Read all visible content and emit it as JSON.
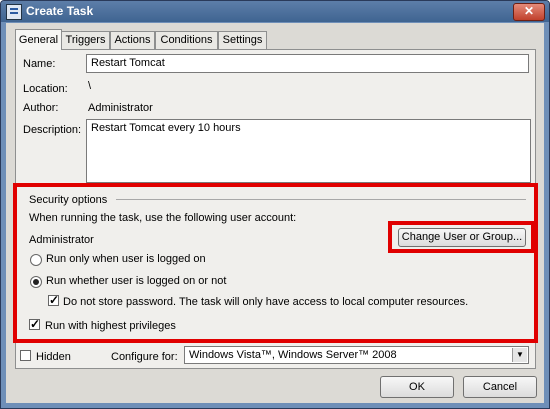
{
  "window": {
    "title": "Create Task"
  },
  "tabs": [
    {
      "label": "General"
    },
    {
      "label": "Triggers"
    },
    {
      "label": "Actions"
    },
    {
      "label": "Conditions"
    },
    {
      "label": "Settings"
    }
  ],
  "general": {
    "name_label": "Name:",
    "name_value": "Restart Tomcat",
    "location_label": "Location:",
    "location_value": "\\",
    "author_label": "Author:",
    "author_value": "Administrator",
    "description_label": "Description:",
    "description_value": "Restart Tomcat every 10 hours"
  },
  "security": {
    "group_label": "Security options",
    "account_prompt": "When running the task, use the following user account:",
    "account_value": "Administrator",
    "change_user_button": "Change User or Group...",
    "radio_logged_on": "Run only when user is logged on",
    "radio_whether": "Run whether user is logged on or not",
    "checkbox_no_password": "Do not store password.  The task will only have access to local computer resources.",
    "checkbox_highest": "Run with highest privileges"
  },
  "bottom": {
    "hidden_label": "Hidden",
    "configure_label": "Configure for:",
    "configure_value": "Windows Vista™, Windows Server™ 2008",
    "ok_button": "OK",
    "cancel_button": "Cancel"
  }
}
